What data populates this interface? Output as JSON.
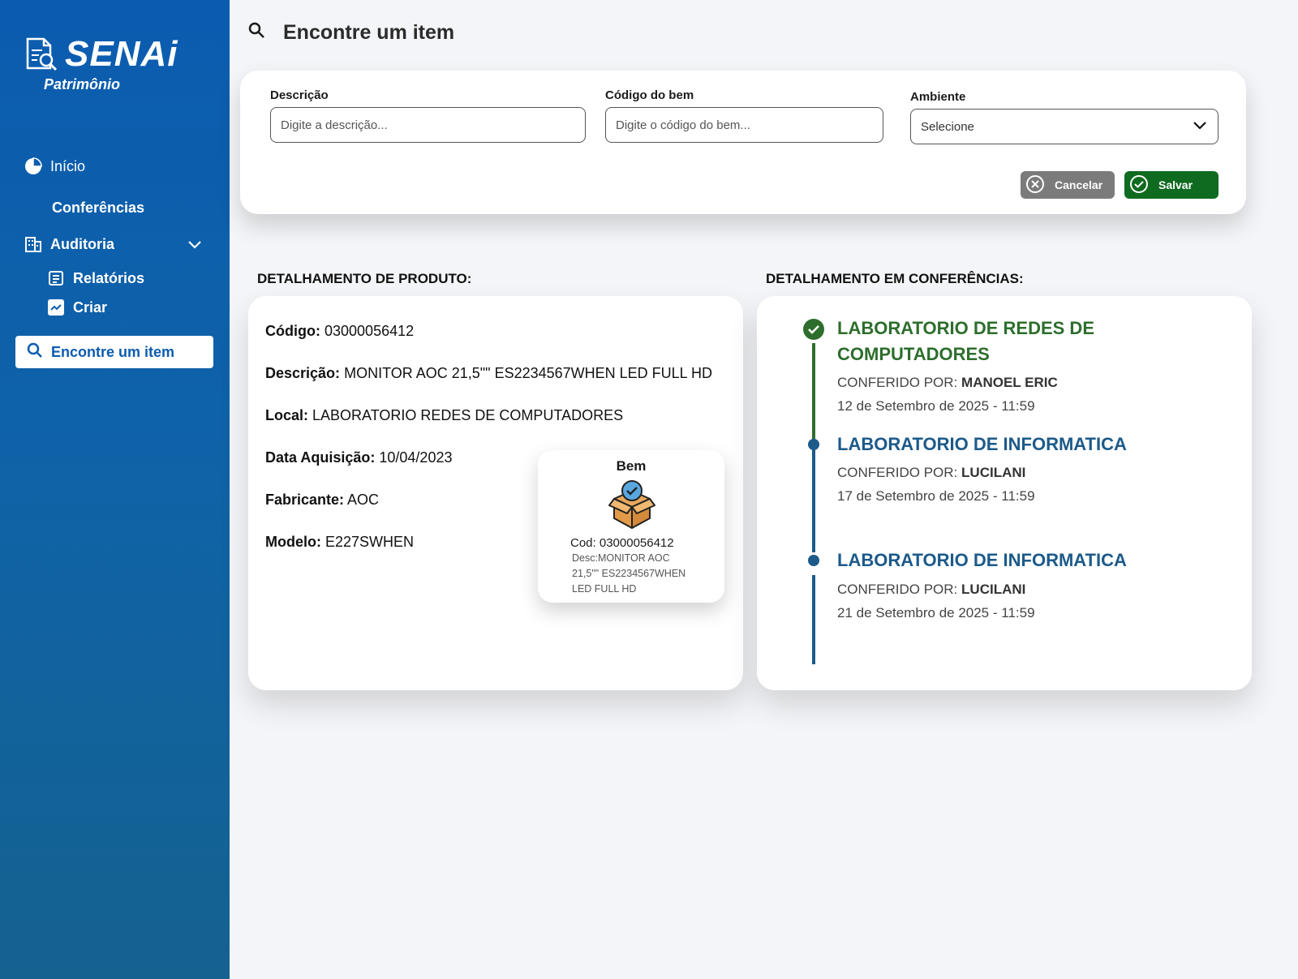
{
  "brand": {
    "name": "SENAi",
    "subtitle": "Patrimônio"
  },
  "sidebar": {
    "items": [
      {
        "label": "Início"
      },
      {
        "label": "Conferências"
      },
      {
        "label": "Auditoria"
      },
      {
        "label": "Relatórios"
      },
      {
        "label": "Criar"
      },
      {
        "label": "Encontre um item"
      }
    ]
  },
  "header": {
    "title": "Encontre um item"
  },
  "filters": {
    "descricao": {
      "label": "Descrição",
      "placeholder": "Digite a descrição..."
    },
    "codigo": {
      "label": "Código do bem",
      "placeholder": "Digite o código do bem..."
    },
    "ambiente": {
      "label": "Ambiente",
      "value": "Selecione"
    },
    "cancel_label": "Cancelar",
    "save_label": "Salvar"
  },
  "product": {
    "section_title": "DETALHAMENTO DE PRODUTO:",
    "fields": [
      {
        "label": "Código:",
        "value": "03000056412"
      },
      {
        "label": "Descrição:",
        "value": "MONITOR AOC 21,5\"\" ES2234567WHEN LED FULL HD"
      },
      {
        "label": "Local:",
        "value": "LABORATORIO REDES DE COMPUTADORES"
      },
      {
        "label": "Data Aquisição:",
        "value": "10/04/2023"
      },
      {
        "label": "Fabricante:",
        "value": "AOC"
      },
      {
        "label": "Modelo:",
        "value": "E227SWHEN"
      }
    ],
    "bem_card": {
      "title": "Bem",
      "cod": "Cod: 03000056412",
      "desc": "Desc:MONITOR AOC 21,5\"\" ES2234567WHEN LED FULL HD"
    }
  },
  "conferences": {
    "section_title": "DETALHAMENTO EM CONFERÊNCIAS:",
    "items": [
      {
        "place": "LABORATORIO DE REDES DE COMPUTADORES",
        "by_label": "CONFERIDO POR:",
        "by": "MANOEL ERIC",
        "date": "12 de Setembro de 2025 - 11:59"
      },
      {
        "place": "LABORATORIO DE INFORMATICA",
        "by_label": "CONFERIDO POR:",
        "by": "LUCILANI",
        "date": "17 de Setembro de 2025 - 11:59"
      },
      {
        "place": "LABORATORIO DE INFORMATICA",
        "by_label": "CONFERIDO POR:",
        "by": "LUCILANI",
        "date": "21 de Setembro de 2025 - 11:59"
      }
    ]
  },
  "colors": {
    "sidebar": "#0b5cb0",
    "accent_green": "#2d6e2d",
    "accent_blue": "#1c5a8a",
    "save": "#0f6b20",
    "cancel": "#7b7b7b"
  }
}
